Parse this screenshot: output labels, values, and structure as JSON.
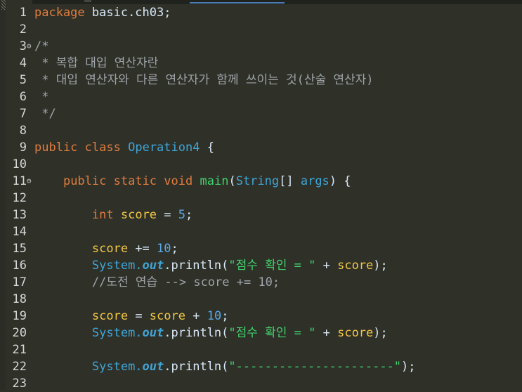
{
  "editor": {
    "lines": [
      {
        "num": "1",
        "fold": "",
        "tokens": [
          {
            "c": "kw",
            "t": "package"
          },
          {
            "c": "plain",
            "t": " basic.ch03;"
          }
        ]
      },
      {
        "num": "2",
        "fold": "",
        "tokens": []
      },
      {
        "num": "3",
        "fold": "⊖",
        "tokens": [
          {
            "c": "cmt",
            "t": "/*"
          }
        ]
      },
      {
        "num": "4",
        "fold": "",
        "tokens": [
          {
            "c": "cmt",
            "t": " * 복합 대입 연산자란"
          }
        ]
      },
      {
        "num": "5",
        "fold": "",
        "tokens": [
          {
            "c": "cmt",
            "t": " * 대입 연산자와 다른 연산자가 함께 쓰이는 것(산술 연산자)"
          }
        ]
      },
      {
        "num": "6",
        "fold": "",
        "tokens": [
          {
            "c": "cmt",
            "t": " *"
          }
        ]
      },
      {
        "num": "7",
        "fold": "",
        "tokens": [
          {
            "c": "cmt",
            "t": " */"
          }
        ]
      },
      {
        "num": "8",
        "fold": "",
        "tokens": []
      },
      {
        "num": "9",
        "fold": "",
        "tokens": [
          {
            "c": "kw",
            "t": "public"
          },
          {
            "c": "plain",
            "t": " "
          },
          {
            "c": "kw",
            "t": "class"
          },
          {
            "c": "plain",
            "t": " "
          },
          {
            "c": "cls",
            "t": "Operation4"
          },
          {
            "c": "plain",
            "t": " {"
          }
        ]
      },
      {
        "num": "10",
        "fold": "",
        "tokens": []
      },
      {
        "num": "11",
        "fold": "⊖",
        "tokens": [
          {
            "c": "plain",
            "t": "    "
          },
          {
            "c": "kw",
            "t": "public"
          },
          {
            "c": "plain",
            "t": " "
          },
          {
            "c": "kw",
            "t": "static"
          },
          {
            "c": "plain",
            "t": " "
          },
          {
            "c": "kw",
            "t": "void"
          },
          {
            "c": "plain",
            "t": " "
          },
          {
            "c": "mth",
            "t": "main"
          },
          {
            "c": "plain",
            "t": "("
          },
          {
            "c": "type",
            "t": "String"
          },
          {
            "c": "plain",
            "t": "[] "
          },
          {
            "c": "type",
            "t": "args"
          },
          {
            "c": "plain",
            "t": ") {"
          }
        ]
      },
      {
        "num": "12",
        "fold": "",
        "tokens": []
      },
      {
        "num": "13",
        "fold": "",
        "tokens": [
          {
            "c": "plain",
            "t": "        "
          },
          {
            "c": "kw",
            "t": "int"
          },
          {
            "c": "plain",
            "t": " "
          },
          {
            "c": "var",
            "t": "score"
          },
          {
            "c": "plain",
            "t": " = "
          },
          {
            "c": "num",
            "t": "5"
          },
          {
            "c": "plain",
            "t": ";"
          }
        ]
      },
      {
        "num": "14",
        "fold": "",
        "tokens": []
      },
      {
        "num": "15",
        "fold": "",
        "tokens": [
          {
            "c": "plain",
            "t": "        "
          },
          {
            "c": "var",
            "t": "score"
          },
          {
            "c": "plain",
            "t": " += "
          },
          {
            "c": "num",
            "t": "10"
          },
          {
            "c": "plain",
            "t": ";"
          }
        ]
      },
      {
        "num": "16",
        "fold": "",
        "tokens": [
          {
            "c": "plain",
            "t": "        "
          },
          {
            "c": "type",
            "t": "System."
          },
          {
            "c": "fld",
            "t": "out"
          },
          {
            "c": "plain",
            "t": ".println("
          },
          {
            "c": "str",
            "t": "\"점수 확인 = \""
          },
          {
            "c": "plain",
            "t": " + "
          },
          {
            "c": "var",
            "t": "score"
          },
          {
            "c": "plain",
            "t": ");"
          }
        ]
      },
      {
        "num": "17",
        "fold": "",
        "tokens": [
          {
            "c": "plain",
            "t": "        "
          },
          {
            "c": "cmt",
            "t": "//도전 연습 --> score += 10;"
          }
        ]
      },
      {
        "num": "18",
        "fold": "",
        "tokens": []
      },
      {
        "num": "19",
        "fold": "",
        "tokens": [
          {
            "c": "plain",
            "t": "        "
          },
          {
            "c": "var",
            "t": "score"
          },
          {
            "c": "plain",
            "t": " = "
          },
          {
            "c": "var",
            "t": "score"
          },
          {
            "c": "plain",
            "t": " + "
          },
          {
            "c": "num",
            "t": "10"
          },
          {
            "c": "plain",
            "t": ";"
          }
        ]
      },
      {
        "num": "20",
        "fold": "",
        "tokens": [
          {
            "c": "plain",
            "t": "        "
          },
          {
            "c": "type",
            "t": "System."
          },
          {
            "c": "fld",
            "t": "out"
          },
          {
            "c": "plain",
            "t": ".println("
          },
          {
            "c": "str",
            "t": "\"점수 확인 = \""
          },
          {
            "c": "plain",
            "t": " + "
          },
          {
            "c": "var",
            "t": "score"
          },
          {
            "c": "plain",
            "t": ");"
          }
        ]
      },
      {
        "num": "21",
        "fold": "",
        "tokens": []
      },
      {
        "num": "22",
        "fold": "",
        "tokens": [
          {
            "c": "plain",
            "t": "        "
          },
          {
            "c": "type",
            "t": "System."
          },
          {
            "c": "fld",
            "t": "out"
          },
          {
            "c": "plain",
            "t": ".println("
          },
          {
            "c": "str",
            "t": "\"----------------------\""
          },
          {
            "c": "plain",
            "t": ");"
          }
        ]
      },
      {
        "num": "23",
        "fold": "",
        "tokens": []
      }
    ]
  },
  "colors": {
    "background": "#2f3129",
    "keyword": "#e07c3e",
    "type": "#3fa5d6",
    "variable": "#f2c744",
    "number": "#5ba8e6",
    "string": "#41d16b",
    "comment": "#9ea3a8"
  }
}
